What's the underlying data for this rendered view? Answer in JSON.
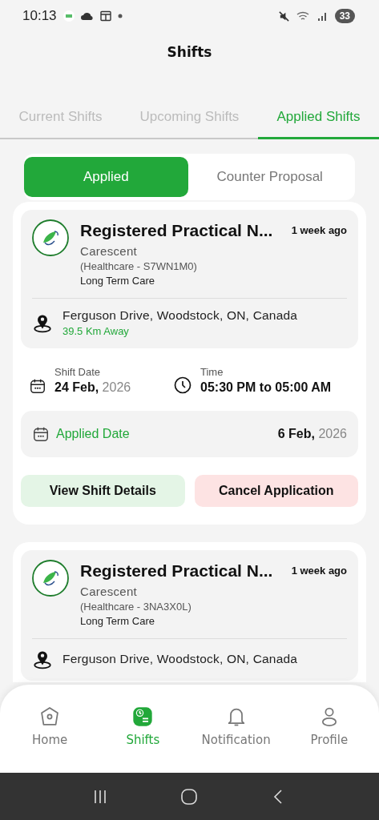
{
  "status_bar": {
    "time": "10:13",
    "battery": "33"
  },
  "header": {
    "title": "Shifts"
  },
  "tabs": [
    {
      "label": "Current Shifts",
      "selected": false
    },
    {
      "label": "Upcoming Shifts",
      "selected": false
    },
    {
      "label": "Applied Shifts",
      "selected": true
    }
  ],
  "segments": [
    {
      "label": "Applied",
      "selected": true
    },
    {
      "label": "Counter Proposal",
      "selected": false
    }
  ],
  "shifts": [
    {
      "title": "Registered Practical N...",
      "posted": "1 week ago",
      "company": "Carescent",
      "code": "(Healthcare - S7WN1M0)",
      "category": "Long Term Care",
      "address": "Ferguson Drive, Woodstock, ON, Canada",
      "distance": "39.5 Km Away",
      "shift_date_label": "Shift Date",
      "shift_date": "**24 Feb,** 2026",
      "time_label": "Time",
      "time": "05:30 PM to 05:00 AM",
      "applied_label": "Applied Date",
      "applied_date": "**6 Feb,** 2026",
      "actions": [
        {
          "label": "View Shift Details",
          "kind": "primary"
        },
        {
          "label": "Cancel Application",
          "kind": "danger"
        }
      ]
    },
    {
      "title": "Registered Practical N...",
      "posted": "1 week ago",
      "company": "Carescent",
      "code": "(Healthcare - 3NA3X0L)",
      "category": "Long Term Care",
      "address": "Ferguson Drive, Woodstock, ON, Canada"
    }
  ],
  "bottom_nav": [
    {
      "label": "Home",
      "kind": "home",
      "selected": false
    },
    {
      "label": "Shifts",
      "kind": "shifts",
      "selected": true
    },
    {
      "label": "Notification",
      "kind": "bell",
      "selected": false
    },
    {
      "label": "Profile",
      "kind": "person",
      "selected": false
    }
  ]
}
